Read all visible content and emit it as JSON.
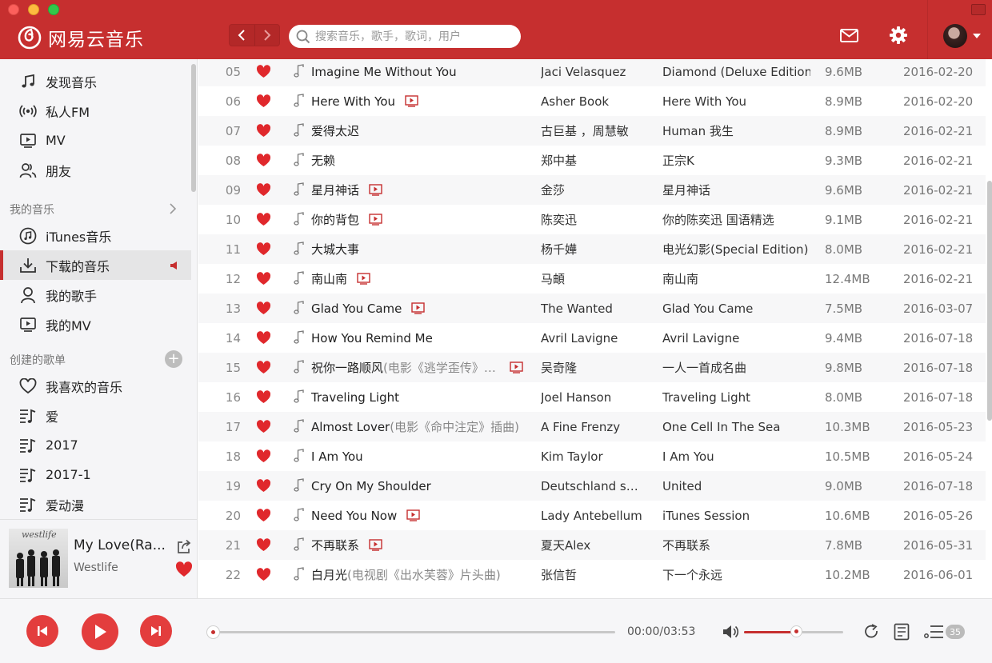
{
  "header": {
    "app_name": "网易云音乐",
    "search_placeholder": "搜索音乐，歌手，歌词，用户"
  },
  "sidebar": {
    "main_items": [
      {
        "label": "发现音乐",
        "icon": "music-note-icon"
      },
      {
        "label": "私人FM",
        "icon": "radio-icon"
      },
      {
        "label": "MV",
        "icon": "video-icon"
      },
      {
        "label": "朋友",
        "icon": "friends-icon"
      }
    ],
    "my_music_title": "我的音乐",
    "my_music_items": [
      {
        "label": "iTunes音乐",
        "icon": "itunes-icon"
      },
      {
        "label": "下载的音乐",
        "icon": "download-icon",
        "active": true
      },
      {
        "label": "我的歌手",
        "icon": "singer-icon"
      },
      {
        "label": "我的MV",
        "icon": "video-icon"
      }
    ],
    "created_title": "创建的歌单",
    "created_items": [
      {
        "label": "我喜欢的音乐",
        "icon": "heart-outline-icon"
      },
      {
        "label": "爱",
        "icon": "playlist-icon"
      },
      {
        "label": "2017",
        "icon": "playlist-icon"
      },
      {
        "label": "2017-1",
        "icon": "playlist-icon"
      },
      {
        "label": "爱动漫",
        "icon": "playlist-icon"
      }
    ]
  },
  "now_playing": {
    "title": "My Love(Ra...",
    "artist": "Westlife",
    "cover_text": "westlife"
  },
  "tracks": [
    {
      "num": "05",
      "title": "Imagine Me Without You",
      "sub": "",
      "mv": false,
      "artist": "Jaci Velasquez",
      "album": "Diamond (Deluxe Edition)",
      "size": "9.6MB",
      "date": "2016-02-20"
    },
    {
      "num": "06",
      "title": "Here With You",
      "sub": "",
      "mv": true,
      "artist": "Asher Book",
      "album": "Here With You",
      "size": "8.9MB",
      "date": "2016-02-20"
    },
    {
      "num": "07",
      "title": "爱得太迟",
      "sub": "",
      "mv": false,
      "artist": "古巨基 ，周慧敏",
      "album": "Human 我生",
      "size": "8.9MB",
      "date": "2016-02-21"
    },
    {
      "num": "08",
      "title": "无赖",
      "sub": "",
      "mv": false,
      "artist": "郑中基",
      "album": "正宗K",
      "size": "9.3MB",
      "date": "2016-02-21"
    },
    {
      "num": "09",
      "title": "星月神话",
      "sub": "",
      "mv": true,
      "artist": "金莎",
      "album": "星月神话",
      "size": "9.6MB",
      "date": "2016-02-21"
    },
    {
      "num": "10",
      "title": "你的背包",
      "sub": "",
      "mv": true,
      "artist": "陈奕迅",
      "album": "你的陈奕迅 国语精选",
      "size": "9.1MB",
      "date": "2016-02-21"
    },
    {
      "num": "11",
      "title": "大城大事",
      "sub": "",
      "mv": false,
      "artist": "杨千嬅",
      "album": "电光幻影(Special Edition)",
      "size": "8.0MB",
      "date": "2016-02-21"
    },
    {
      "num": "12",
      "title": "南山南",
      "sub": "",
      "mv": true,
      "artist": "马頔",
      "album": "南山南",
      "size": "12.4MB",
      "date": "2016-02-21"
    },
    {
      "num": "13",
      "title": "Glad You Came",
      "sub": "",
      "mv": true,
      "artist": "The Wanted",
      "album": "Glad You Came",
      "size": "7.5MB",
      "date": "2016-03-07"
    },
    {
      "num": "14",
      "title": "How You Remind Me",
      "sub": "",
      "mv": false,
      "artist": "Avril Lavigne",
      "album": "Avril Lavigne",
      "size": "9.4MB",
      "date": "2016-07-18"
    },
    {
      "num": "15",
      "title": "祝你一路顺风",
      "sub": "(电影《逃学歪传》…",
      "mv": true,
      "artist": "吴奇隆",
      "album": "一人一首成名曲",
      "size": "9.8MB",
      "date": "2016-07-18"
    },
    {
      "num": "16",
      "title": "Traveling Light",
      "sub": "",
      "mv": false,
      "artist": "Joel Hanson",
      "album": "Traveling Light",
      "size": "8.0MB",
      "date": "2016-07-18"
    },
    {
      "num": "17",
      "title": "Almost Lover",
      "sub": "(电影《命中注定》插曲)",
      "mv": false,
      "artist": "A Fine Frenzy",
      "album": "One Cell In The Sea",
      "size": "10.3MB",
      "date": "2016-05-23"
    },
    {
      "num": "18",
      "title": "I Am You",
      "sub": "",
      "mv": false,
      "artist": "Kim Taylor",
      "album": "I Am You",
      "size": "10.5MB",
      "date": "2016-05-24"
    },
    {
      "num": "19",
      "title": "Cry On My Shoulder",
      "sub": "",
      "mv": false,
      "artist": "Deutschland suc…",
      "album": "United",
      "size": "9.0MB",
      "date": "2016-07-18"
    },
    {
      "num": "20",
      "title": "Need You Now",
      "sub": "",
      "mv": true,
      "artist": "Lady Antebellum",
      "album": "iTunes Session",
      "size": "10.6MB",
      "date": "2016-05-26"
    },
    {
      "num": "21",
      "title": "不再联系",
      "sub": "",
      "mv": true,
      "artist": "夏天Alex",
      "album": "不再联系",
      "size": "7.8MB",
      "date": "2016-05-31"
    },
    {
      "num": "22",
      "title": "白月光",
      "sub": "(电视剧《出水芙蓉》片头曲)",
      "mv": false,
      "artist": "张信哲",
      "album": "下一个永远",
      "size": "10.2MB",
      "date": "2016-06-01"
    }
  ],
  "player": {
    "time": "00:00/03:53",
    "progress": 0,
    "volume": 0.53,
    "playlist_count": "35"
  },
  "colors": {
    "brand": "#c62f2f",
    "heart": "#e0282c",
    "button": "#e33d3d"
  }
}
